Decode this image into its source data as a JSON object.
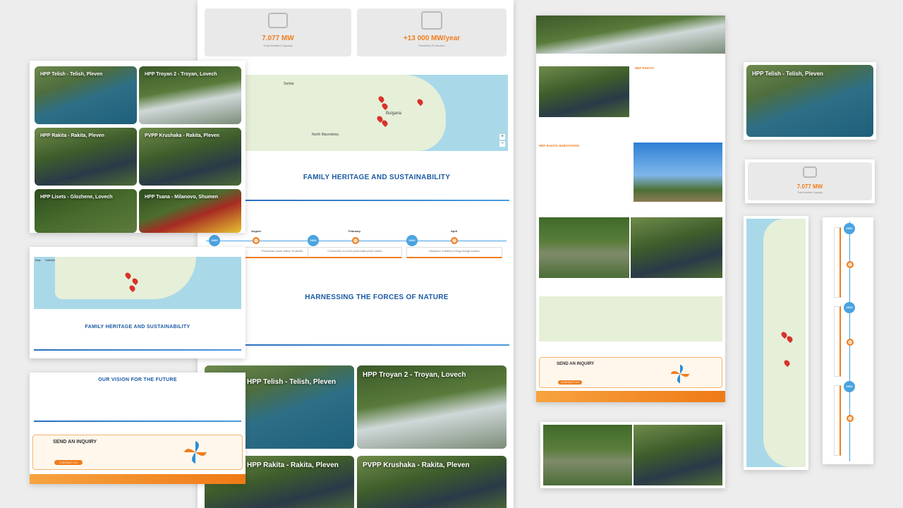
{
  "projects": [
    {
      "label": "HPP Telish - Telish, Pleven"
    },
    {
      "label": "HPP Troyan 2 - Troyan, Lovech"
    },
    {
      "label": "HPP Rakita - Rakita, Pleven"
    },
    {
      "label": "PVPP Krushaka - Rakita, Pleven"
    },
    {
      "label": "HPP Lisets - Glozhene, Lovech"
    },
    {
      "label": "HPP Tsana - Milanovo, Shumen"
    }
  ],
  "stats": {
    "capacity_value": "7.077 MW",
    "capacity_label": "Total Installed Capacity",
    "production_value": "+13 000 MW/year",
    "production_label": "Electricity Production"
  },
  "sections": {
    "heritage_title": "FAMILY HERITAGE AND SUSTAINABILITY",
    "nature_title": "HARNESSING THE FORCES OF NATURE",
    "vision_title": "OUR VISION FOR THE FUTURE",
    "inquiry_title": "SEND AN INQUIRY",
    "hpp_rakita_title": "HEP RAKITA",
    "hpp_rakita_sub_title": "HEP RAKITA SUBSTATION",
    "btn_label": "CONTACT US"
  },
  "timeline": {
    "years": [
      "2022",
      "2024",
      "2024"
    ],
    "months": [
      "August",
      "February",
      "April"
    ],
    "events": [
      "Photovoltaic power station 'Krushaka'",
      "Construction of a new photovoltaic power station",
      "Integration of Battery Energy storage solution"
    ]
  },
  "map_labels": {
    "country": "Bulgaria",
    "map_tab": "Map",
    "satellite_tab": "Satellite",
    "north_macedonia": "North Macedonia",
    "serbia": "Serbia"
  },
  "colors": {
    "accent": "#f07d1d",
    "brand_blue": "#1a5aa3",
    "timeline_blue": "#4aa3e0"
  }
}
